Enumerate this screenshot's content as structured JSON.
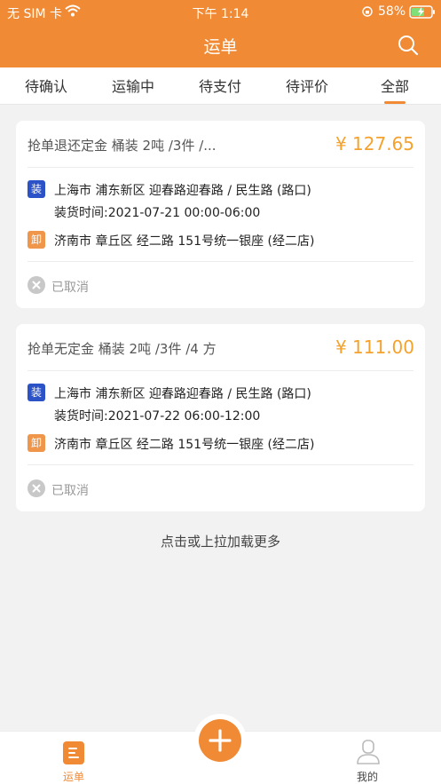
{
  "status_bar": {
    "carrier": "无 SIM 卡",
    "time": "下午 1:14",
    "battery_percent": "58%"
  },
  "nav": {
    "title": "运单",
    "search_icon": "search-icon"
  },
  "tabs": [
    {
      "label": "待确认"
    },
    {
      "label": "运输中"
    },
    {
      "label": "待支付"
    },
    {
      "label": "待评价"
    },
    {
      "label": "全部",
      "active": true
    }
  ],
  "orders": [
    {
      "title": "抢单退还定金 桶装 2吨 /3件 /...",
      "price": "¥ 127.65",
      "load_badge": "装",
      "load_address": "上海市 浦东新区 迎春路迎春路 / 民生路 (路口)",
      "load_time": "装货时间:2021-07-21 00:00-06:00",
      "unload_badge": "卸",
      "unload_address": "济南市 章丘区 经二路 151号统一银座 (经二店)",
      "status": "已取消"
    },
    {
      "title": "抢单无定金 桶装 2吨 /3件 /4 方",
      "price": "¥ 111.00",
      "load_badge": "装",
      "load_address": "上海市 浦东新区 迎春路迎春路 / 民生路 (路口)",
      "load_time": "装货时间:2021-07-22 06:00-12:00",
      "unload_badge": "卸",
      "unload_address": "济南市 章丘区 经二路 151号统一银座 (经二店)",
      "status": "已取消"
    }
  ],
  "load_more": "点击或上拉加载更多",
  "bottom_nav": {
    "waybill_label": "运单",
    "mine_label": "我的"
  },
  "colors": {
    "brand": "#f08a34",
    "price": "#f5a22c",
    "load_badge": "#2b52c6",
    "unload_badge": "#f0964a"
  }
}
